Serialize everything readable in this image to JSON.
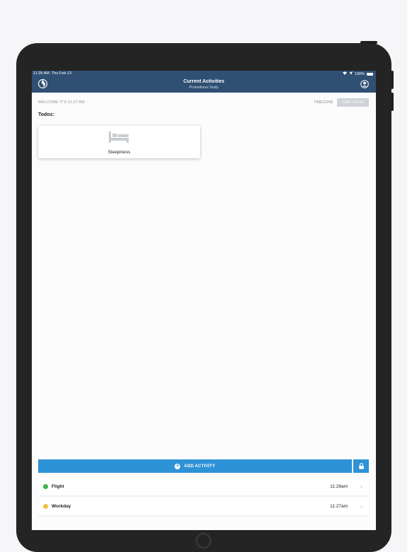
{
  "status_bar": {
    "time": "11:28 AM",
    "date": "Thu Feb 13",
    "battery": "100%"
  },
  "nav": {
    "title": "Current Activities",
    "subtitle": "Prometheus Study"
  },
  "welcome_text": "WELCOME IT'S 11:27 AM",
  "timezone": {
    "label": "TIMEZONE",
    "value": "GMT +01:00"
  },
  "todos": {
    "heading": "Todos:",
    "items": [
      {
        "label": "Sleepiness",
        "icon": "bed-icon"
      }
    ]
  },
  "add_activity_label": "ADD ACTIVITY",
  "activities": [
    {
      "name": "Flight",
      "time": "11:28am",
      "color": "#3cb54a"
    },
    {
      "name": "Workday",
      "time": "11:27am",
      "color": "#f1c040"
    }
  ],
  "colors": {
    "nav_bar": "#2f4f73",
    "accent": "#2d92d6"
  }
}
